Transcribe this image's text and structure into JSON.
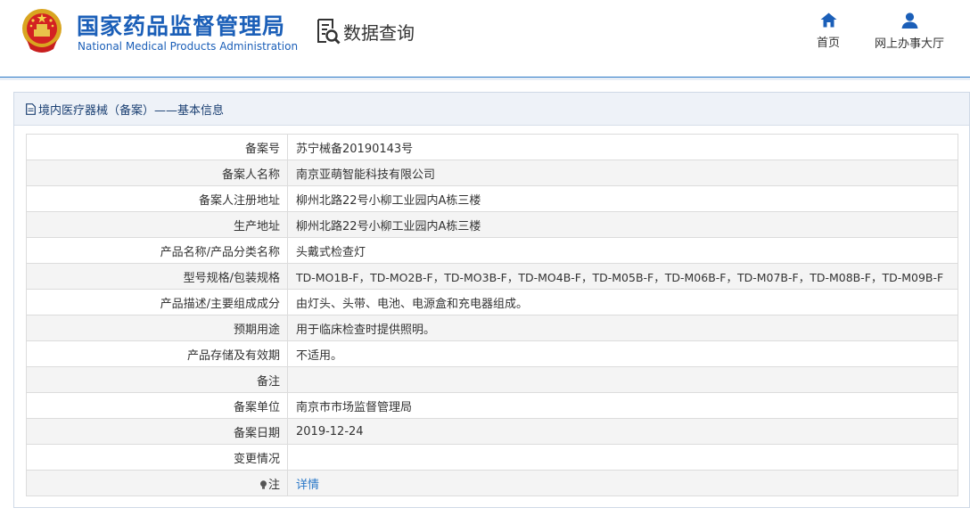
{
  "header": {
    "brand_cn": "国家药品监督管理局",
    "brand_en": "National Medical Products Administration",
    "section_title": "数据查询",
    "nav": [
      {
        "label": "首页",
        "icon": "home-icon"
      },
      {
        "label": "网上办事大厅",
        "icon": "user-icon"
      }
    ],
    "brand_color": "#1b5fb8"
  },
  "panel": {
    "title": "境内医疗器械（备案）——基本信息",
    "rows": [
      {
        "label": "备案号",
        "value": "苏宁械备20190143号"
      },
      {
        "label": "备案人名称",
        "value": "南京亚萌智能科技有限公司"
      },
      {
        "label": "备案人注册地址",
        "value": "柳州北路22号小柳工业园内A栋三楼"
      },
      {
        "label": "生产地址",
        "value": "柳州北路22号小柳工业园内A栋三楼"
      },
      {
        "label": "产品名称/产品分类名称",
        "value": "头戴式检查灯"
      },
      {
        "label": "型号规格/包装规格",
        "value": "TD-MO1B-F，TD-MO2B-F，TD-MO3B-F，TD-MO4B-F，TD-M05B-F，TD-M06B-F，TD-M07B-F，TD-M08B-F，TD-M09B-F"
      },
      {
        "label": "产品描述/主要组成成分",
        "value": "由灯头、头带、电池、电源盒和充电器组成。"
      },
      {
        "label": "预期用途",
        "value": "用于临床检查时提供照明。"
      },
      {
        "label": "产品存储及有效期",
        "value": "不适用。"
      },
      {
        "label": "备注",
        "value": ""
      },
      {
        "label": "备案单位",
        "value": "南京市市场监督管理局"
      },
      {
        "label": "备案日期",
        "value": "2019-12-24"
      },
      {
        "label": "变更情况",
        "value": ""
      },
      {
        "label": "注",
        "value": "详情"
      }
    ],
    "link_color": "#2a78c8"
  }
}
